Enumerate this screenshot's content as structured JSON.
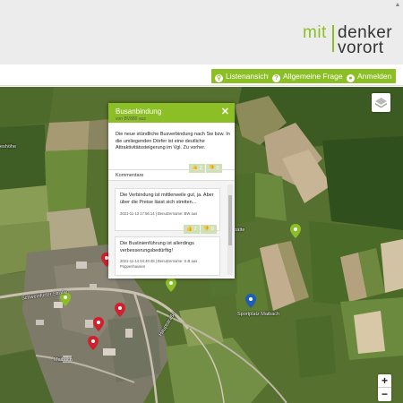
{
  "header": {
    "logo": {
      "part1": "mit",
      "part2": "denker",
      "part3": "vorort"
    },
    "buttons": [
      {
        "label": "Listenansicht",
        "icon": "map-marker-icon"
      },
      {
        "label": "Allgemeine Fragen",
        "icon": "question-icon"
      },
      {
        "label": "Anmelden",
        "icon": "user-icon"
      }
    ]
  },
  "map": {
    "labels": {
      "street1": "Schweinfurter Straße",
      "street2": "Hauptstraße",
      "place1": "Sportplatz Maibach",
      "place2": "Maibach",
      "edge1": "eshöhe",
      "edge2": "stätte"
    },
    "zoom_in": "+",
    "zoom_out": "−"
  },
  "popup": {
    "title": "Busanbindung",
    "author": "von BV880 aus",
    "description": "Die neue stündliche Busverbindung nach Sw bzw. In die umliegenden Dörfer ist eine deutliche Attraktivitätssteigerung im Vgl. Zu vorher.",
    "likes": "2",
    "dislikes": "0",
    "comments_heading": "Kommentare",
    "comments": [
      {
        "text": "Die Verbindung ist mittlerweile gut, ja. Aber über die Preise lässt sich streiten...",
        "meta": "2021-11-13 17:56:14 | Benutzername: BW aus",
        "likes": "2",
        "dislikes": "0"
      },
      {
        "text": "Die Buslinienführung ist allerdings verbesserungsbedürftig!",
        "meta": "2021-11-14 04:49:48 | Benutzername: S.B aus Poppenhausen",
        "likes": "1",
        "dislikes": "0"
      }
    ]
  },
  "colors": {
    "accent": "#8cbf26",
    "pin_red": "#d0202e",
    "pin_green": "#8cbf26",
    "pin_blue": "#1e5fb4"
  }
}
